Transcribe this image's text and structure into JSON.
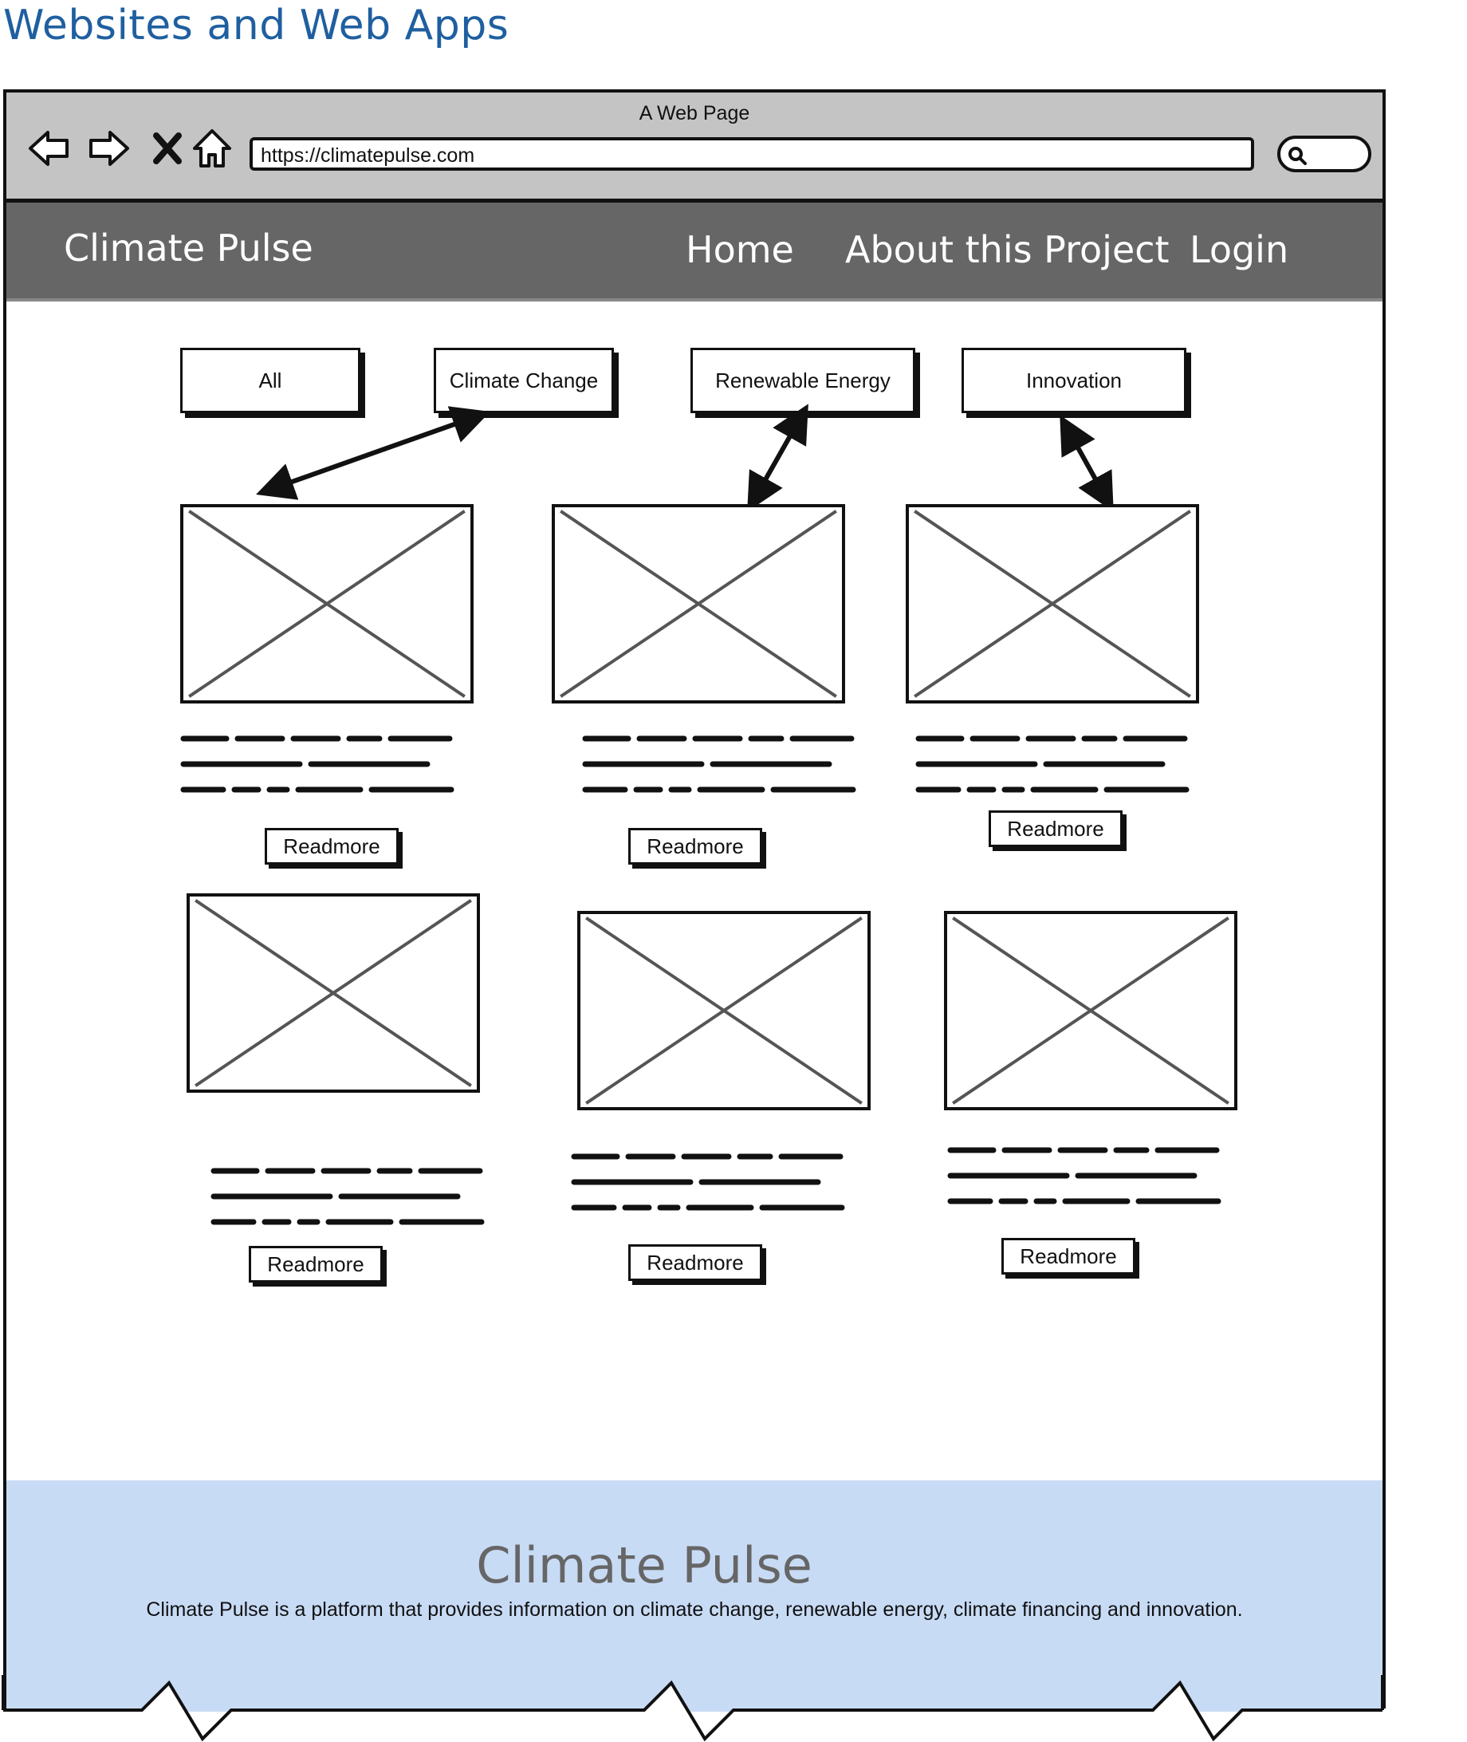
{
  "page": {
    "heading": "Websites and Web Apps"
  },
  "browser": {
    "window_title": "A Web Page",
    "url": "https://climatepulse.com"
  },
  "nav": {
    "brand": "Climate Pulse",
    "links": [
      "Home",
      "About this Project",
      "Login"
    ]
  },
  "filters": [
    "All",
    "Climate Change",
    "Renewable Energy",
    "Innovation"
  ],
  "cards": [
    {
      "button": "Readmore"
    },
    {
      "button": "Readmore"
    },
    {
      "button": "Readmore"
    },
    {
      "button": "Readmore"
    },
    {
      "button": "Readmore"
    },
    {
      "button": "Readmore"
    }
  ],
  "footer": {
    "title": "Climate Pulse",
    "text": "Climate Pulse is a platform that provides information on climate change, renewable energy, climate financing and innovation."
  }
}
